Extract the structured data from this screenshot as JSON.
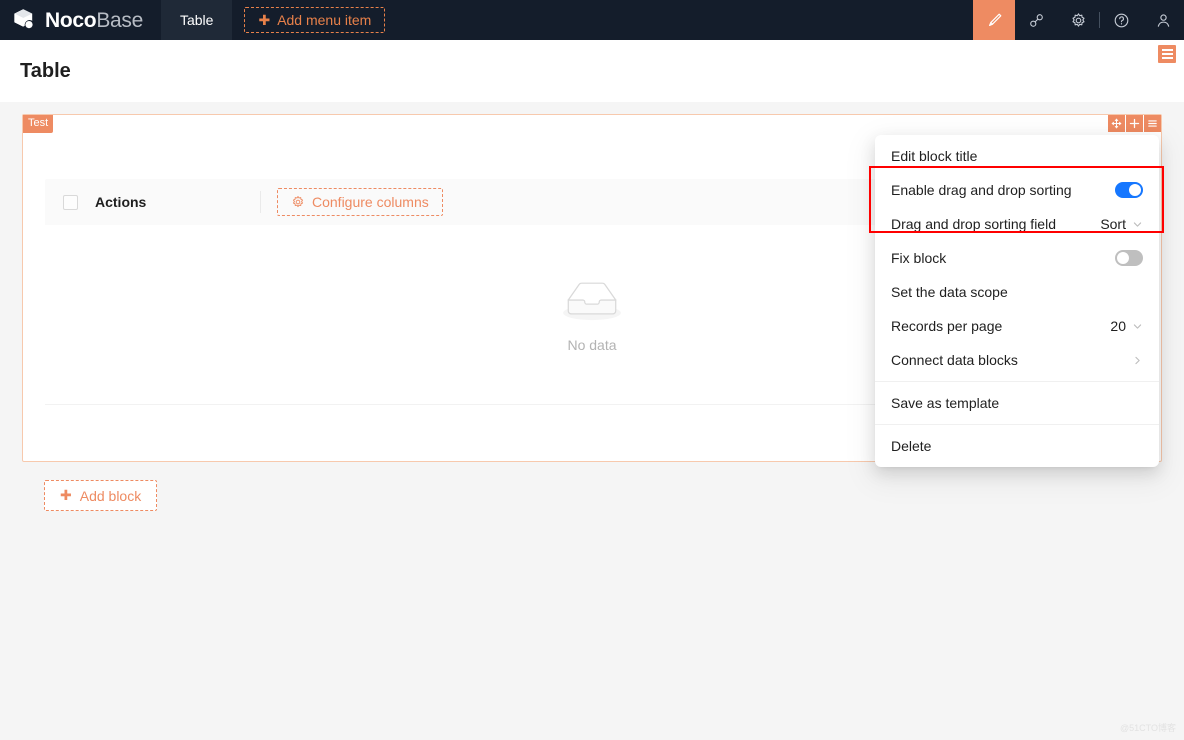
{
  "header": {
    "brand": {
      "primary": "Noco",
      "secondary": "Base",
      "logo_icon": "cube-logo-icon"
    },
    "nav_items": [
      {
        "label": "Table",
        "active": true
      }
    ],
    "add_menu_item_label": "Add menu item",
    "actions": [
      {
        "name": "ui-editor-icon",
        "label": "UI Editor",
        "active": true
      },
      {
        "name": "plugin-settings-icon",
        "label": "Plugin settings",
        "active": false
      },
      {
        "name": "gear-icon",
        "label": "Settings",
        "active": false
      },
      {
        "name": "help-icon",
        "label": "Help",
        "active": false
      },
      {
        "name": "user-avatar-icon",
        "label": "Account",
        "active": false
      }
    ]
  },
  "page": {
    "title": "Table",
    "designer_toggle_name": "page-designer-toggle"
  },
  "block": {
    "badge": "Test",
    "tools": [
      {
        "name": "drag-move-icon",
        "label": "Drag"
      },
      {
        "name": "plus-icon",
        "label": "Add"
      },
      {
        "name": "menu-icon",
        "label": "Block settings"
      }
    ],
    "table": {
      "columns": [
        "Actions"
      ],
      "configure_columns_label": "Configure columns",
      "configure_columns_icon": "gear-icon",
      "empty_text": "No data",
      "empty_icon": "empty-inbox-icon"
    }
  },
  "add_block_label": "Add block",
  "dropdown": {
    "items": [
      {
        "label": "Edit block title",
        "type": "plain"
      },
      {
        "label": "Enable drag and drop sorting",
        "type": "switch",
        "switch_on": true
      },
      {
        "label": "Drag and drop sorting field",
        "type": "select",
        "value": "Sort"
      },
      {
        "label": "Fix block",
        "type": "switch",
        "switch_on": false
      },
      {
        "label": "Set the data scope",
        "type": "plain"
      },
      {
        "label": "Records per page",
        "type": "select",
        "value": "20"
      },
      {
        "label": "Connect data blocks",
        "type": "submenu"
      },
      {
        "label": "Save as template",
        "type": "plain",
        "divider_before": true
      },
      {
        "label": "Delete",
        "type": "plain",
        "divider_before": true
      }
    ]
  },
  "annotation": {
    "name": "red-highlight-box"
  },
  "watermark": "@51CTO博客",
  "colors": {
    "brand_dark": "#141d2b",
    "accent_orange": "#ee8b62",
    "switch_on": "#1677ff",
    "switch_off": "#bfbfbf",
    "annotation_red": "#ff0000",
    "page_bg": "#f5f5f5"
  }
}
